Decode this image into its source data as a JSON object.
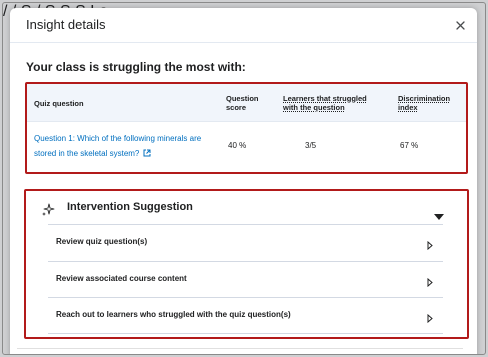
{
  "dialog": {
    "title": "Insight details",
    "close_icon": "close-icon"
  },
  "heading": "Your class is struggling the most with:",
  "table": {
    "columns": [
      "Quiz question",
      "Question score",
      "Learners that struggled with the question",
      "Discrimination index"
    ],
    "rows": [
      {
        "question": "Question 1: Which of the following minerals are stored in the skeletal system?",
        "question_icon": "external-link-icon",
        "score": "40 %",
        "learners": "3/5",
        "discrimination": "67 %"
      }
    ]
  },
  "intervention": {
    "icon": "sparkle-icon",
    "title": "Intervention Suggestion",
    "toggle_icon": "caret-down-icon",
    "items": [
      {
        "label": "Review quiz question(s)",
        "icon": "chevron-right-icon"
      },
      {
        "label": "Review associated course content",
        "icon": "chevron-right-icon"
      },
      {
        "label": "Reach out to learners who struggled with the quiz question(s)",
        "icon": "chevron-right-icon"
      }
    ]
  },
  "highlight_color": "#b21a1a",
  "link_color": "#006fbf"
}
